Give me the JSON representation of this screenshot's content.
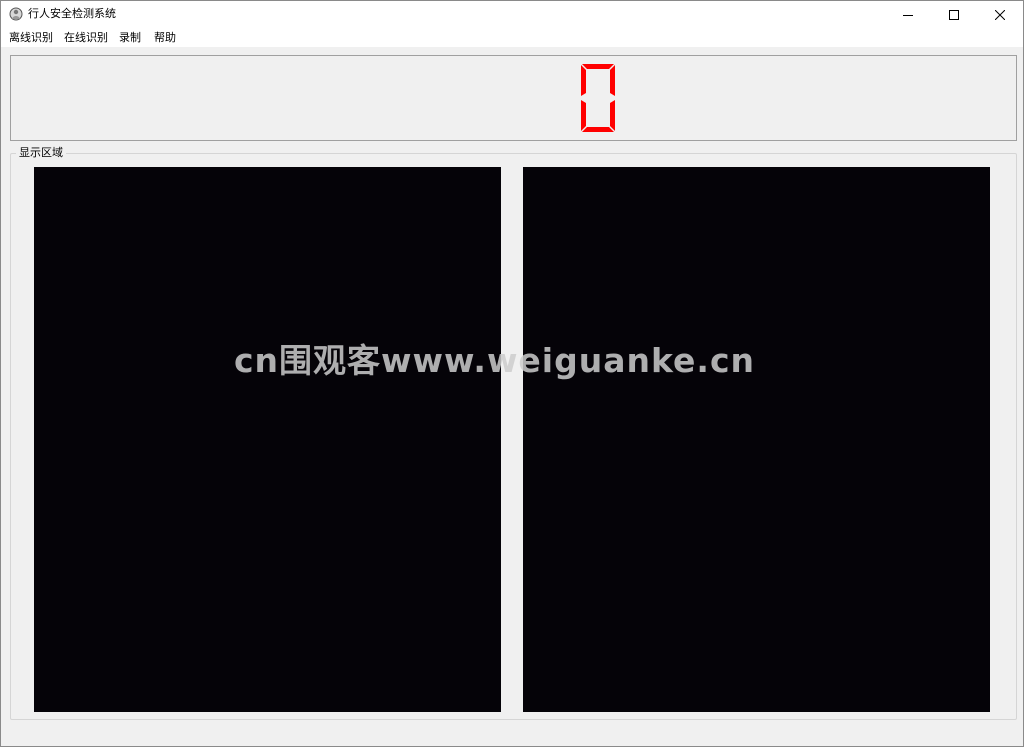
{
  "window": {
    "title": "行人安全检测系统",
    "controls": {
      "minimize_icon": "minimize-icon",
      "maximize_icon": "maximize-icon",
      "close_icon": "close-icon"
    }
  },
  "menu": {
    "items": [
      {
        "label": "离线识别"
      },
      {
        "label": "在线识别"
      },
      {
        "label": "录制"
      },
      {
        "label": "帮助"
      }
    ]
  },
  "counter": {
    "value": "0",
    "color": "#ff0000"
  },
  "display": {
    "group_title": "显示区域",
    "panel_color": "#050308"
  },
  "watermark": {
    "text": "cn围观客www.weiguanke.cn"
  },
  "colors": {
    "window_bg": "#f0f0f0",
    "titlebar_bg": "#ffffff",
    "lcd_red": "#ff0000"
  }
}
